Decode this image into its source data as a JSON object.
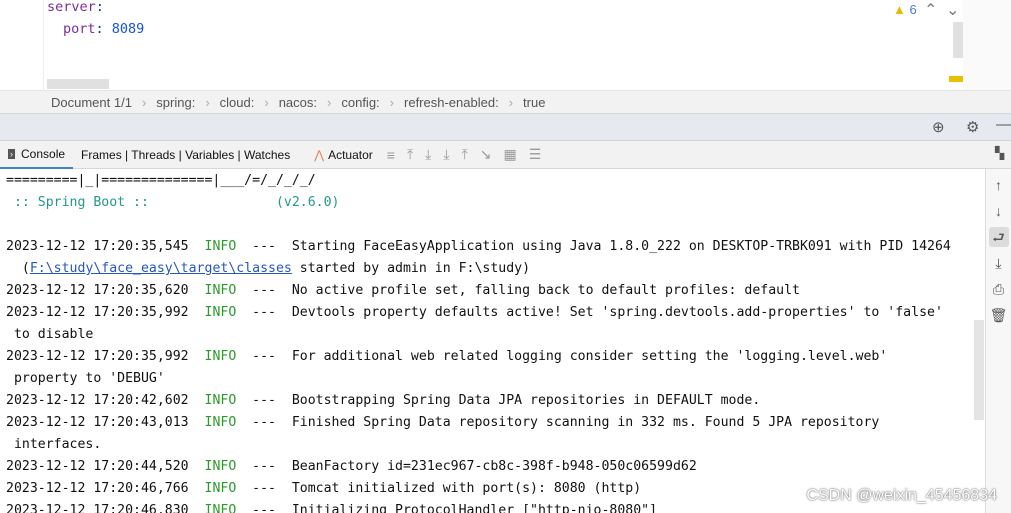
{
  "editor": {
    "lines": [
      {
        "key": "server",
        "sep": ":"
      },
      {
        "key": "port",
        "sep": ": ",
        "value": "8089"
      }
    ],
    "warnings": "6"
  },
  "breadcrumb": [
    "Document 1/1",
    "spring:",
    "cloud:",
    "nacos:",
    "config:",
    "refresh-enabled:",
    "true"
  ],
  "toolbar": {
    "tabs": [
      {
        "label": "Console"
      },
      {
        "label": "Frames | Threads | Variables | Watches"
      },
      {
        "label": "Actuator"
      }
    ]
  },
  "console": {
    "banner": [
      "=========|_|==============|___/=/_/_/_/",
      " :: Spring Boot ::                (v2.6.0)"
    ],
    "logs": [
      {
        "time": "2023-12-12 17:20:35,545",
        "level": "INFO",
        "msg": "Starting FaceEasyApplication using Java 1.8.0_222 on DESKTOP-TRBK091 with PID 14264",
        "cont_link": "F:\\study\\face_easy\\target\\classes",
        "cont": " started by admin in F:\\study)"
      },
      {
        "time": "2023-12-12 17:20:35,620",
        "level": "INFO",
        "msg": "No active profile set, falling back to default profiles: default"
      },
      {
        "time": "2023-12-12 17:20:35,992",
        "level": "INFO",
        "msg": "Devtools property defaults active! Set 'spring.devtools.add-properties' to 'false'",
        "cont": "to disable"
      },
      {
        "time": "2023-12-12 17:20:35,992",
        "level": "INFO",
        "msg": "For additional web related logging consider setting the 'logging.level.web'",
        "cont": "property to 'DEBUG'"
      },
      {
        "time": "2023-12-12 17:20:42,602",
        "level": "INFO",
        "msg": "Bootstrapping Spring Data JPA repositories in DEFAULT mode."
      },
      {
        "time": "2023-12-12 17:20:43,013",
        "level": "INFO",
        "msg": "Finished Spring Data repository scanning in 332 ms. Found 5 JPA repository",
        "cont": "interfaces."
      },
      {
        "time": "2023-12-12 17:20:44,520",
        "level": "INFO",
        "msg": "BeanFactory id=231ec967-cb8c-398f-b948-050c06599d62"
      },
      {
        "time": "2023-12-12 17:20:46,766",
        "level": "INFO",
        "msg": "Tomcat initialized with port(s): 8080 (http)"
      },
      {
        "time": "2023-12-12 17:20:46,830",
        "level": "INFO",
        "msg": "Initializing ProtocolHandler [\"http-nio-8080\"]"
      }
    ]
  },
  "watermark": "CSDN @weixin_45456834"
}
